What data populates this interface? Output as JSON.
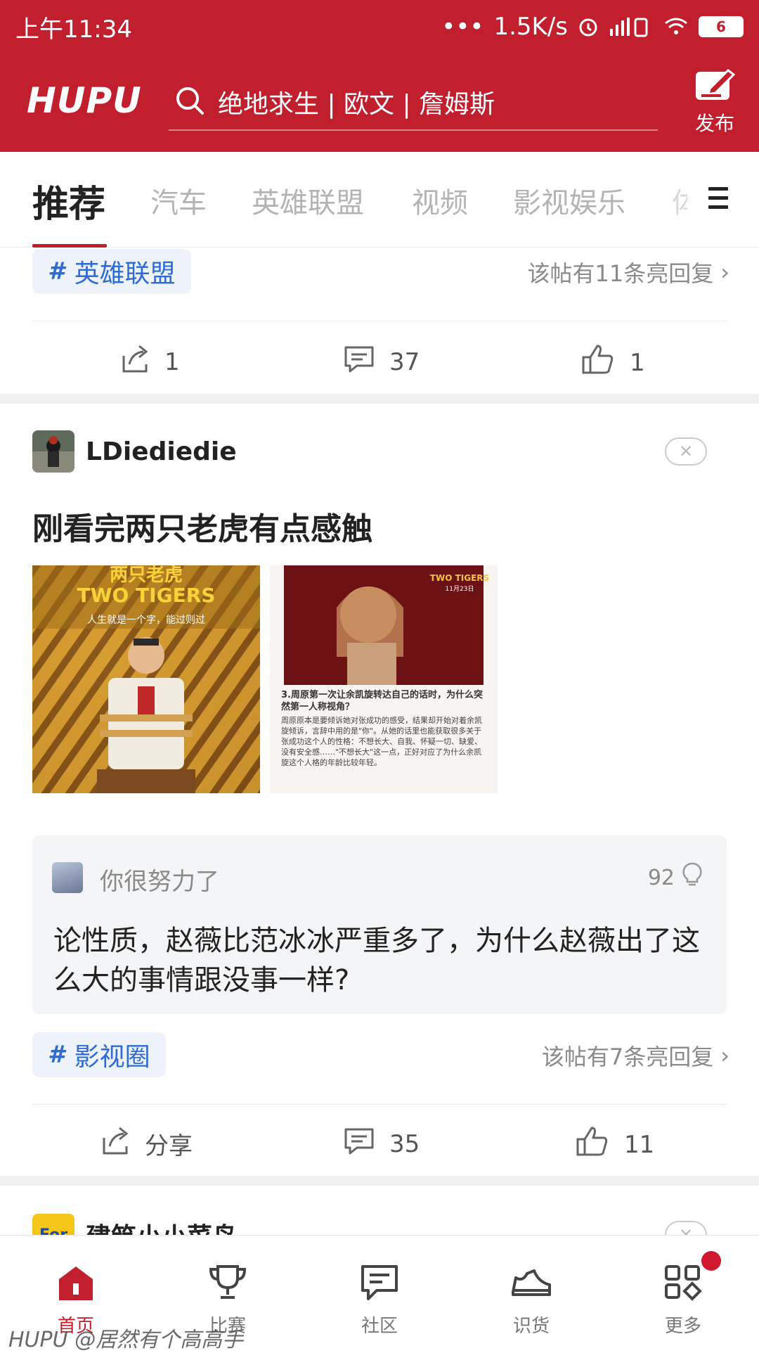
{
  "status_bar": {
    "time": "上午11:34",
    "network_speed": "1.5K/s",
    "battery": "6"
  },
  "header": {
    "logo": "HUPU",
    "search_placeholder": "绝地求生 | 欧文 | 詹姆斯",
    "publish_label": "发布",
    "accent_color": "#c11e2e"
  },
  "tabs": [
    {
      "label": "推荐",
      "active": true
    },
    {
      "label": "汽车",
      "active": false
    },
    {
      "label": "英雄联盟",
      "active": false
    },
    {
      "label": "视频",
      "active": false
    },
    {
      "label": "影视娱乐",
      "active": false
    },
    {
      "label": "体",
      "active": false
    }
  ],
  "post1": {
    "tag": "英雄联盟",
    "hot_replies": "该帖有11条亮回复",
    "share_count": "1",
    "comment_count": "37",
    "like_count": "1"
  },
  "post2": {
    "username": "LDiediedie",
    "title": "刚看完两只老虎有点感触",
    "images": [
      {
        "poster_title": "两只老虎",
        "poster_en": "TWO TIGERS",
        "poster_slogan": "人生就是一个字，能过则过"
      },
      {
        "poster_en": "TWO TIGERS",
        "poster_date": "11月23日",
        "caption_heading": "3.周原第一次让余凯旋转达自己的话时，为什么突然第一人称视角？",
        "caption_body": "周原原本是要倾诉她对张成功的感受，结果却开始对着余凯旋倾诉，言辞中用的是\"你\"。从她的话里也能获取很多关于张成功这个人的性格：不想长大、自我、怀疑一切、缺爱、没有安全感……\"不想长大\"这一点，正好对应了为什么余凯旋这个人格的年龄比较年轻。"
      }
    ],
    "comment": {
      "user": "你很努力了",
      "likes": "92",
      "text": "论性质，赵薇比范冰冰严重多了，为什么赵薇出了这么大的事情跟没事一样?"
    },
    "tag": "影视圈",
    "hot_replies": "该帖有7条亮回复",
    "share_label": "分享",
    "comment_count": "35",
    "like_count": "11"
  },
  "post3": {
    "username": "建筑小小菜鸟",
    "avatar_text": "For"
  },
  "bottom_nav": [
    {
      "label": "首页",
      "icon": "home-icon",
      "active": true
    },
    {
      "label": "比赛",
      "icon": "trophy-icon",
      "active": false
    },
    {
      "label": "社区",
      "icon": "chat-icon",
      "active": false
    },
    {
      "label": "识货",
      "icon": "sneaker-icon",
      "active": false
    },
    {
      "label": "更多",
      "icon": "grid-icon",
      "active": false
    }
  ],
  "watermark": "HUPU @居然有个高高手"
}
